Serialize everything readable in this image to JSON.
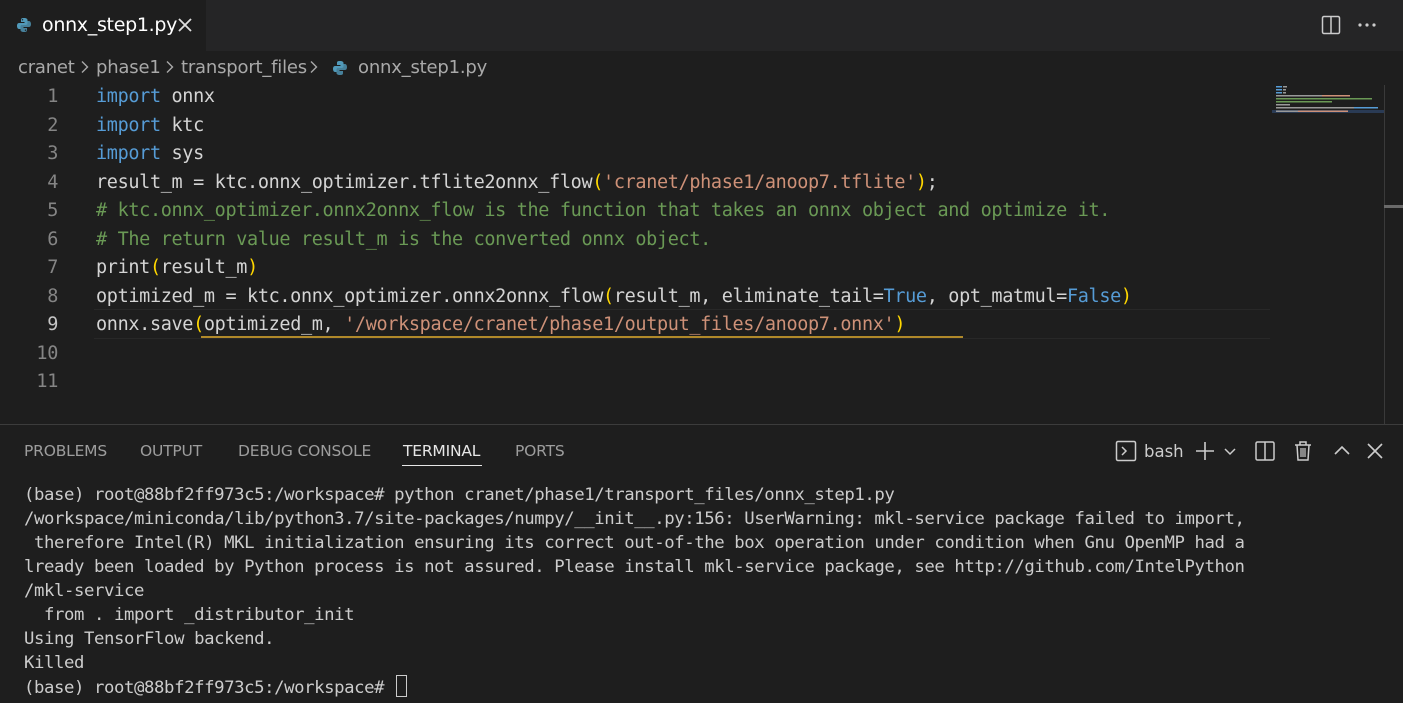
{
  "tab": {
    "filename": "onnx_step1.py"
  },
  "breadcrumb": {
    "parts": [
      "cranet",
      "phase1",
      "transport_files",
      "onnx_step1.py"
    ]
  },
  "editor": {
    "line_numbers": [
      "1",
      "2",
      "3",
      "4",
      "5",
      "6",
      "7",
      "8",
      "9",
      "10",
      "11"
    ],
    "active_line": "9",
    "lines": [
      [
        {
          "t": "import",
          "c": "kw"
        },
        {
          "t": " onnx",
          "c": "fn"
        }
      ],
      [
        {
          "t": "import",
          "c": "kw"
        },
        {
          "t": " ktc",
          "c": "fn"
        }
      ],
      [
        {
          "t": "import",
          "c": "kw"
        },
        {
          "t": " sys",
          "c": "fn"
        }
      ],
      [
        {
          "t": "result_m = ktc.onnx_optimizer.tflite2onnx_flow",
          "c": "fn"
        },
        {
          "t": "(",
          "c": "br"
        },
        {
          "t": "'cranet/phase1/anoop7.tflite'",
          "c": "str"
        },
        {
          "t": ")",
          "c": "br"
        },
        {
          "t": ";",
          "c": "fn"
        }
      ],
      [
        {
          "t": "# ktc.onnx_optimizer.onnx2onnx_flow is the function that takes an onnx object and optimize it.",
          "c": "cm"
        }
      ],
      [
        {
          "t": "# The return value result_m is the converted onnx object.",
          "c": "cm"
        }
      ],
      [
        {
          "t": "print",
          "c": "fn"
        },
        {
          "t": "(",
          "c": "br"
        },
        {
          "t": "result_m",
          "c": "fn"
        },
        {
          "t": ")",
          "c": "br"
        }
      ],
      [
        {
          "t": "optimized_m = ktc.onnx_optimizer.onnx2onnx_flow",
          "c": "fn"
        },
        {
          "t": "(",
          "c": "br"
        },
        {
          "t": "result_m, eliminate_tail=",
          "c": "fn"
        },
        {
          "t": "True",
          "c": "kw"
        },
        {
          "t": ", opt_matmul=",
          "c": "fn"
        },
        {
          "t": "False",
          "c": "kw"
        },
        {
          "t": ")",
          "c": "br"
        }
      ],
      [
        {
          "t": "onnx.save",
          "c": "fn"
        },
        {
          "t": "(",
          "c": "br"
        },
        {
          "t": "optimized_m, ",
          "c": "fn"
        },
        {
          "t": "'/workspace/cranet/phase1/output_files/anoop7.onnx'",
          "c": "str"
        },
        {
          "t": ")",
          "c": "br"
        }
      ],
      [],
      []
    ]
  },
  "panel": {
    "tabs": [
      "PROBLEMS",
      "OUTPUT",
      "DEBUG CONSOLE",
      "TERMINAL",
      "PORTS"
    ],
    "active_tab": "TERMINAL",
    "shell": "bash",
    "icons": [
      "terminal-icon",
      "plus-icon",
      "chevron-down-icon",
      "split-icon",
      "trash-icon",
      "maximize-icon",
      "close-icon"
    ]
  },
  "terminal": {
    "lines": [
      "(base) root@88bf2ff973c5:/workspace# python cranet/phase1/transport_files/onnx_step1.py",
      "/workspace/miniconda/lib/python3.7/site-packages/numpy/__init__.py:156: UserWarning: mkl-service package failed to import,",
      " therefore Intel(R) MKL initialization ensuring its correct out-of-the box operation under condition when Gnu OpenMP had a",
      "lready been loaded by Python process is not assured. Please install mkl-service package, see http://github.com/IntelPython",
      "/mkl-service",
      "  from . import _distributor_init",
      "Using TensorFlow backend.",
      "Killed"
    ],
    "prompt": "(base) root@88bf2ff973c5:/workspace# "
  },
  "colors": {
    "background": "#1e1e1e",
    "tabbar": "#252526",
    "keyword": "#569cd6",
    "string": "#ce9178",
    "comment": "#6a9955",
    "bracket": "#ffd700"
  }
}
